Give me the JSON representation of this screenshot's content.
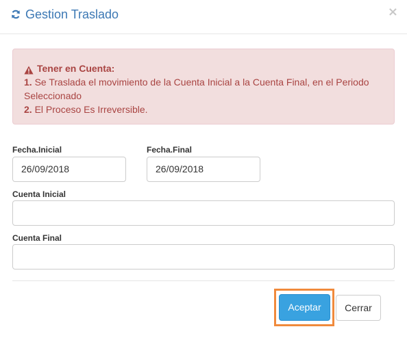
{
  "modal": {
    "title": "Gestion Traslado",
    "close_label": "×"
  },
  "alert": {
    "heading": "Tener en Cuenta:",
    "items": [
      {
        "num": "1.",
        "text": " Se Traslada el movimiento de la Cuenta Inicial a la Cuenta Final, en el Periodo Seleccionado"
      },
      {
        "num": "2.",
        "text": " El Proceso Es Irreversible."
      }
    ]
  },
  "form": {
    "fecha_inicial": {
      "label": "Fecha.Inicial",
      "value": "26/09/2018"
    },
    "fecha_final": {
      "label": "Fecha.Final",
      "value": "26/09/2018"
    },
    "cuenta_inicial": {
      "label": "Cuenta Inicial",
      "value": ""
    },
    "cuenta_final": {
      "label": "Cuenta Final",
      "value": ""
    }
  },
  "footer": {
    "accept_label": "Aceptar",
    "close_label": "Cerrar"
  },
  "icons": {
    "title": "refresh-icon",
    "alert": "warning-icon",
    "close": "close-icon"
  },
  "colors": {
    "title": "#3c78b4",
    "alert_bg": "#f2dede",
    "alert_text": "#a94442",
    "primary": "#39a2e0",
    "focus": "#f08a3c"
  }
}
